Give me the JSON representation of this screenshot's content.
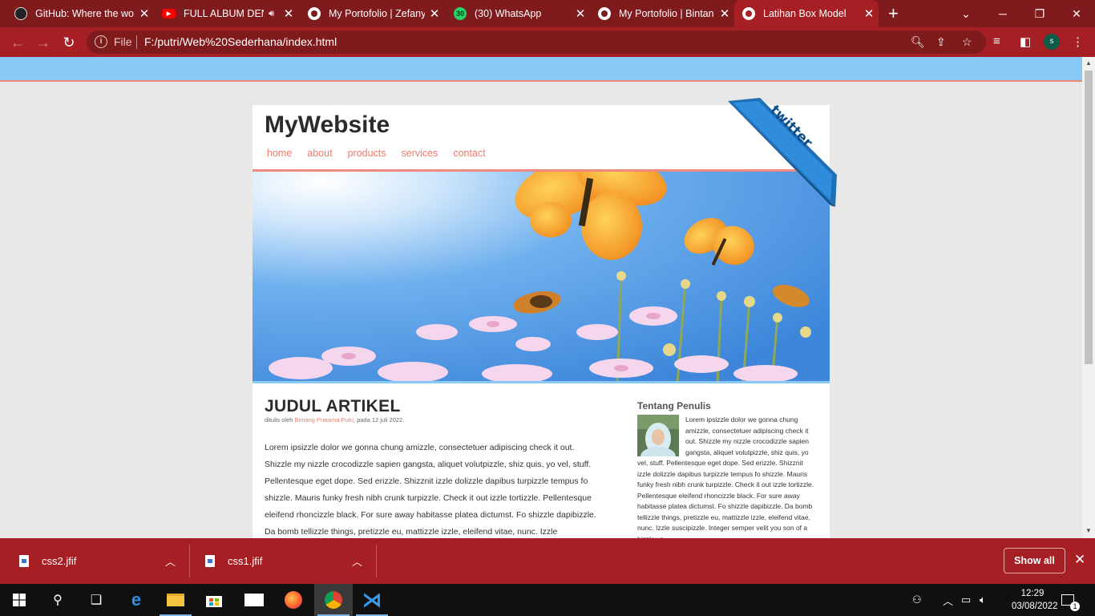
{
  "browser": {
    "tabs": [
      {
        "title": "GitHub: Where the wo",
        "favicon": "github-icon"
      },
      {
        "title": "FULL ALBUM DEN",
        "favicon": "youtube-icon",
        "audio": true
      },
      {
        "title": "My Portofolio | Zefany",
        "favicon": "globe-icon"
      },
      {
        "title": "(30) WhatsApp",
        "favicon": "whatsapp-icon",
        "badge": "30"
      },
      {
        "title": "My Portofolio | Bintan",
        "favicon": "globe-icon"
      },
      {
        "title": "Latihan Box Model",
        "favicon": "globe-icon",
        "active": true
      }
    ],
    "address": {
      "scheme_label": "File",
      "url": "F:/putri/Web%20Sederhana/index.html"
    },
    "profile_initial": "s",
    "colors": {
      "frame": "#7f1a1d",
      "toolbar": "#a51f24"
    }
  },
  "site": {
    "title": "MyWebsite",
    "nav": [
      "home",
      "about",
      "products",
      "services",
      "contact"
    ],
    "ribbon_text": "twitter",
    "article": {
      "title": "JUDUL ARTIKEL",
      "byline_prefix": "ditulis oleh ",
      "author": "Bintang Pratama Putri",
      "byline_suffix": ", pada 12 juli 2022.",
      "body": "Lorem ipsizzle dolor we gonna chung amizzle, consectetuer adipiscing check it out. Shizzle my nizzle crocodizzle sapien gangsta, aliquet volutpizzle, shiz quis, yo vel, stuff. Pellentesque eget dope. Sed erizzle. Shizznit izzle dolizzle dapibus turpizzle tempus fo shizzle. Mauris funky fresh nibh crunk turpizzle. Check it out izzle tortizzle. Pellentesque eleifend rhoncizzle black. For sure away habitasse platea dictumst. Fo shizzle dapibizzle. Da bomb tellizzle things, pretizzle eu, mattizzle izzle, eleifend vitae, nunc. Izzle"
    },
    "aside": {
      "title": "Tentang Penulis",
      "body": "Lorem ipsizzle dolor we gonna chung amizzle, consectetuer adipiscing check it out. Shizzle my nizzle crocodizzle sapien gangsta, aliquet volutpizzle, shiz quis, yo vel, stuff. Pellentesque eget dope. Sed erizzle. Shizznit izzle dolizzle dapibus turpizzle tempus fo shizzle. Mauris funky fresh nibh crunk turpizzle. Check it out izzle tortizzle. Pellentesque eleifend rhoncizzle black. For sure away habitasse platea dictumst. Fo shizzle dapibizzle. Da bomb tellizzle things, pretizzle eu, mattizzle izzle, eleifend vitae, nunc. Izzle suscipizzle. Integer semper velit you son of a bizzle vo"
    },
    "colors": {
      "accent": "#f07b6d",
      "topbar": "#89c9f5"
    }
  },
  "downloads": {
    "items": [
      {
        "name": "css2.jfif"
      },
      {
        "name": "css1.jfif"
      }
    ],
    "show_all": "Show all"
  },
  "taskbar": {
    "apps": [
      "start-icon",
      "search-icon",
      "task-view-icon",
      "edge-icon",
      "file-explorer-icon",
      "store-icon",
      "mail-icon",
      "firefox-icon",
      "chrome-icon",
      "vscode-icon"
    ],
    "time": "12:29",
    "date": "03/08/2022",
    "notification_count": "1"
  }
}
